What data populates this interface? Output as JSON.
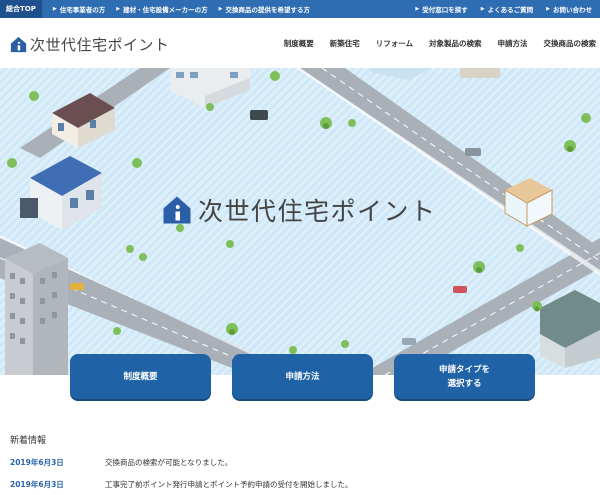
{
  "topbar": {
    "home": "総合TOP",
    "audience": [
      "住宅事業者の方",
      "建材・住宅設備メーカーの方",
      "交換商品の提供を希望する方"
    ],
    "utility": [
      "受付窓口を探す",
      "よくあるご質問",
      "お問い合わせ"
    ]
  },
  "header": {
    "logo_text": "次世代住宅ポイント",
    "nav": [
      "制度概要",
      "新築住宅",
      "リフォーム",
      "対象製品の検索",
      "申請方法",
      "交換商品の検索"
    ]
  },
  "hero": {
    "title": "次世代住宅ポイント"
  },
  "cta": {
    "overview": "制度概要",
    "apply": "申請方法",
    "select_type": "申請タイプを\n選択する"
  },
  "news": {
    "heading": "新着情報",
    "items": [
      {
        "date": "2019年6月3日",
        "text": "交換商品の検索が可能となりました。"
      },
      {
        "date": "2019年6月3日",
        "text": "工事完了前ポイント発行申請とポイント予約申請の受付を開始しました。"
      }
    ]
  },
  "colors": {
    "brand_blue": "#2f6db3",
    "button_blue": "#1f62a6",
    "date_blue": "#2a63a8"
  }
}
